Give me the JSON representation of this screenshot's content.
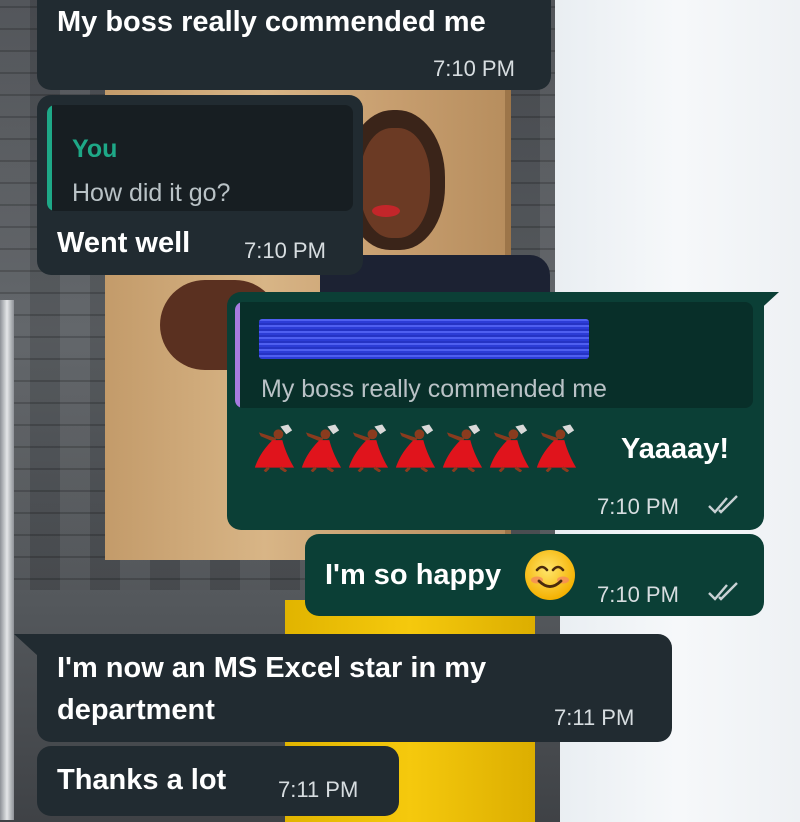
{
  "messages": [
    {
      "direction": "in",
      "text": "My boss really commended me",
      "time": "7:10 PM"
    },
    {
      "direction": "in",
      "quote": {
        "author": "You",
        "text": "How did it go?"
      },
      "text": "Went well",
      "time": "7:10 PM"
    },
    {
      "direction": "out",
      "quote": {
        "author": "",
        "text": "My boss really commended me"
      },
      "emoji": "💃💃💃💃💃💃💃",
      "text": "Yaaaay!",
      "time": "7:10 PM",
      "status": "read"
    },
    {
      "direction": "out",
      "text": "I'm so happy",
      "emoji": "😊",
      "time": "7:10 PM",
      "status": "read"
    },
    {
      "direction": "in",
      "lines": [
        "I'm now an MS Excel star in my",
        "department"
      ],
      "time": "7:11 PM"
    },
    {
      "direction": "in",
      "text": "Thanks a lot",
      "time": "7:11 PM"
    }
  ],
  "colors": {
    "incoming_bubble": "#212b31",
    "outgoing_bubble": "#0b3f36",
    "quote_author": "#1ea887",
    "quote_bar_incoming": "#1ea887",
    "quote_bar_outgoing": "#a77be0",
    "redaction": "#3a48e0",
    "read_ticks": "#c9d1d4"
  },
  "icons": [
    "read-receipt-double-check-icon",
    "woman-dancing-emoji",
    "smiling-face-emoji"
  ]
}
